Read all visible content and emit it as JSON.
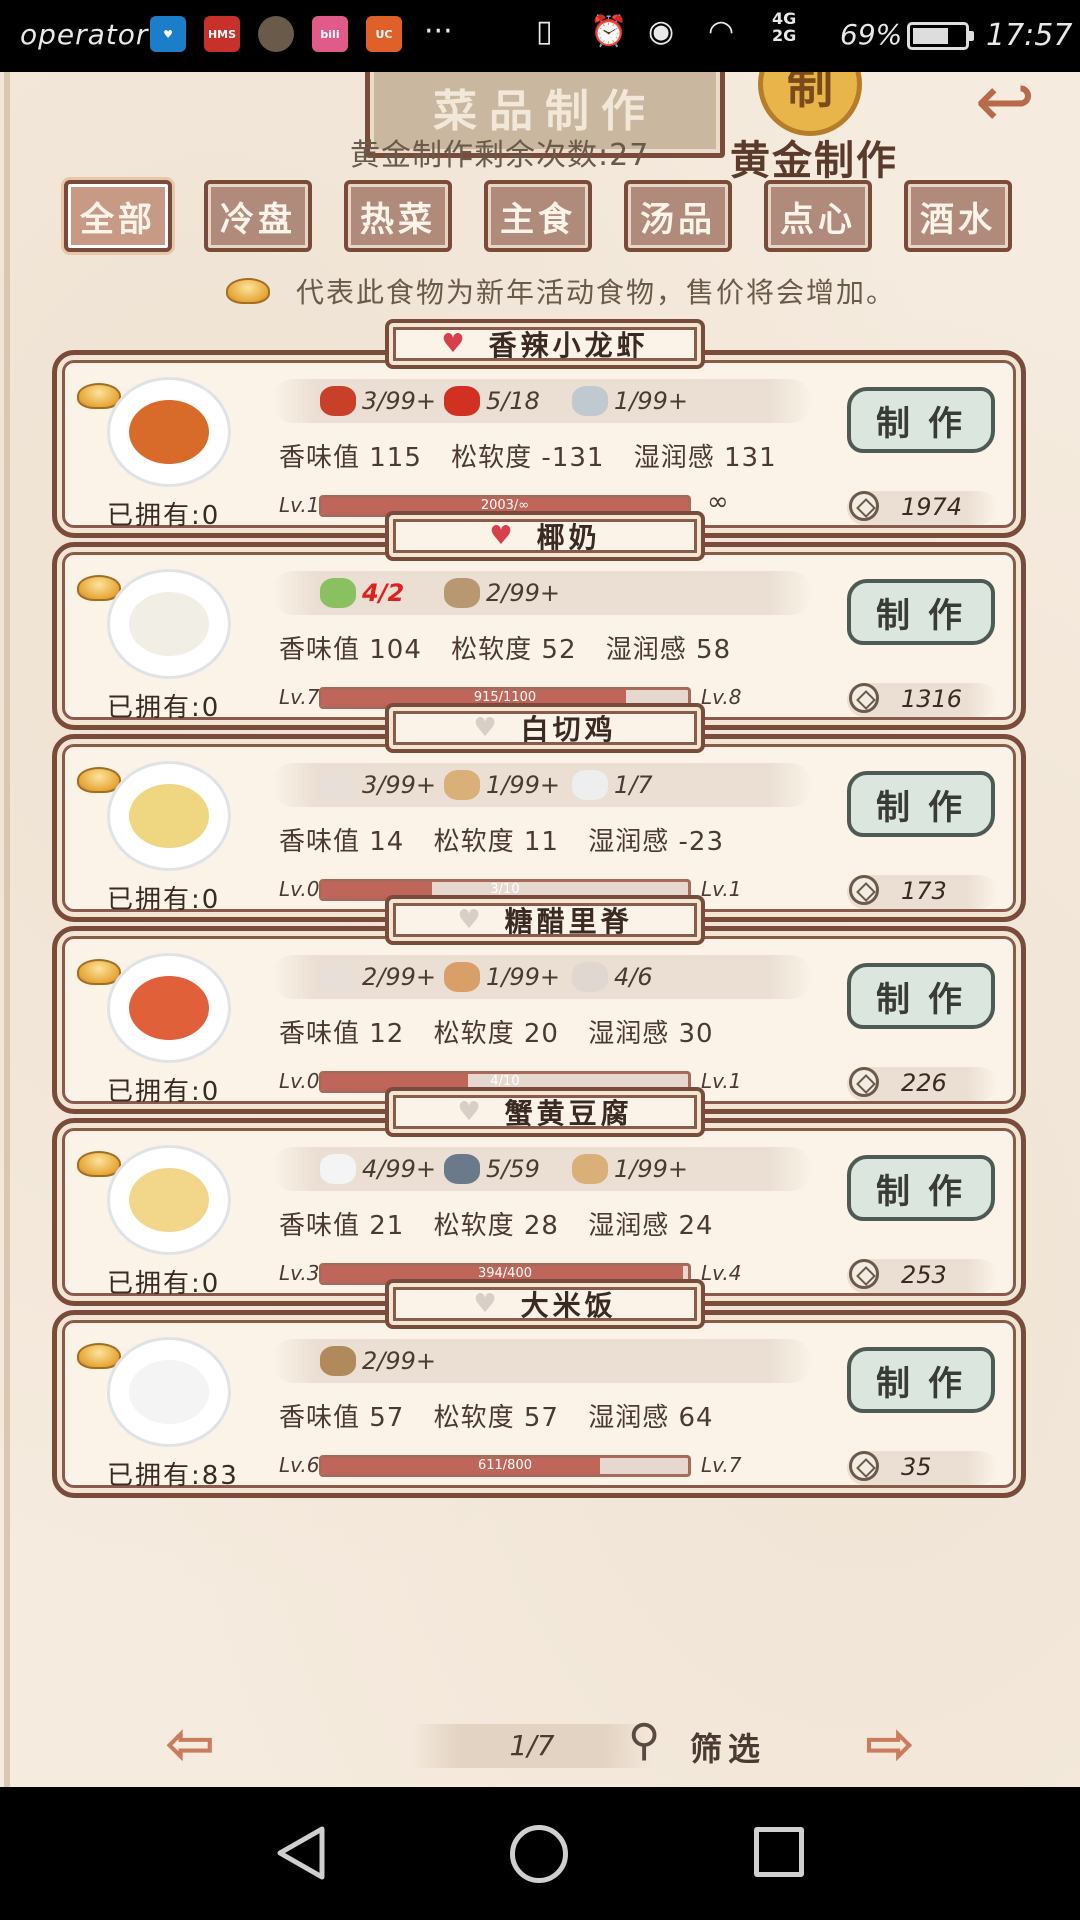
{
  "status_bar": {
    "operator": "operator",
    "apps": [
      "health-app",
      "HMS",
      "avatar-app",
      "bilibili",
      "uc-browser"
    ],
    "hms_label": "HMS",
    "more": "···",
    "network_top": "4G",
    "network_bottom": "2G",
    "battery_percent": "69%",
    "battery_level": 0.69,
    "time": "17:57"
  },
  "header": {
    "title": "菜品制作",
    "seal_char": "制",
    "gold_remaining": "黄金制作剩余次数:27",
    "gold_label": "黄金制作"
  },
  "tabs": [
    {
      "label": "全部",
      "active": true
    },
    {
      "label": "冷盘",
      "active": false
    },
    {
      "label": "热菜",
      "active": false
    },
    {
      "label": "主食",
      "active": false
    },
    {
      "label": "汤品",
      "active": false
    },
    {
      "label": "点心",
      "active": false
    },
    {
      "label": "酒水",
      "active": false
    }
  ],
  "notice": "代表此食物为新年活动食物，售价将会增加。",
  "dishes": [
    {
      "name": "香辣小龙虾",
      "favorite": true,
      "ingredients": [
        {
          "icon": "crayfish-icon",
          "qty": "3/99+",
          "short": false
        },
        {
          "icon": "chili-icon",
          "qty": "5/18",
          "short": false
        },
        {
          "icon": "pot-icon",
          "qty": "1/99+",
          "short": false
        }
      ],
      "stats": {
        "aroma": "香味值 115",
        "softness": "松软度 -131",
        "moisture": "湿润感 131"
      },
      "owned": "已拥有:0",
      "level": "Lv.10",
      "next_level": "∞",
      "progress_text": "2003/∞",
      "progress": 1.0,
      "price": "1974",
      "make_label": "制作",
      "food_color": "#d86a2a"
    },
    {
      "name": "椰奶",
      "favorite": true,
      "ingredients": [
        {
          "icon": "coconut-icon",
          "qty": "4/2",
          "short": true
        },
        {
          "icon": "barrel-icon",
          "qty": "2/99+",
          "short": false
        }
      ],
      "stats": {
        "aroma": "香味值 104",
        "softness": "松软度 52",
        "moisture": "湿润感 58"
      },
      "owned": "已拥有:0",
      "level": "Lv.7",
      "next_level": "Lv.8",
      "progress_text": "915/1100",
      "progress": 0.83,
      "price": "1316",
      "make_label": "制作",
      "food_color": "#f1eee6"
    },
    {
      "name": "白切鸡",
      "favorite": false,
      "ingredients": [
        {
          "icon": "chicken-icon",
          "qty": "3/99+",
          "short": false
        },
        {
          "icon": "ginger-icon",
          "qty": "1/99+",
          "short": false
        },
        {
          "icon": "bottle-icon",
          "qty": "1/7",
          "short": false
        }
      ],
      "stats": {
        "aroma": "香味值 14",
        "softness": "松软度 11",
        "moisture": "湿润感 -23"
      },
      "owned": "已拥有:0",
      "level": "Lv.0",
      "next_level": "Lv.1",
      "progress_text": "3/10",
      "progress": 0.3,
      "price": "173",
      "make_label": "制作",
      "food_color": "#efd680"
    },
    {
      "name": "糖醋里脊",
      "favorite": false,
      "ingredients": [
        {
          "icon": "chicken-icon",
          "qty": "2/99+",
          "short": false
        },
        {
          "icon": "egg-icon",
          "qty": "1/99+",
          "short": false
        },
        {
          "icon": "plate-icon",
          "qty": "4/6",
          "short": false
        }
      ],
      "stats": {
        "aroma": "香味值 12",
        "softness": "松软度 20",
        "moisture": "湿润感 30"
      },
      "owned": "已拥有:0",
      "level": "Lv.0",
      "next_level": "Lv.1",
      "progress_text": "4/10",
      "progress": 0.4,
      "price": "226",
      "make_label": "制作",
      "food_color": "#e0603a"
    },
    {
      "name": "蟹黄豆腐",
      "favorite": false,
      "ingredients": [
        {
          "icon": "tofu-icon",
          "qty": "4/99+",
          "short": false
        },
        {
          "icon": "crab-icon",
          "qty": "5/59",
          "short": false
        },
        {
          "icon": "ginger-icon",
          "qty": "1/99+",
          "short": false
        }
      ],
      "stats": {
        "aroma": "香味值 21",
        "softness": "松软度 28",
        "moisture": "湿润感 24"
      },
      "owned": "已拥有:0",
      "level": "Lv.3",
      "next_level": "Lv.4",
      "progress_text": "394/400",
      "progress": 0.985,
      "price": "253",
      "make_label": "制作",
      "food_color": "#f2d78a"
    },
    {
      "name": "大米饭",
      "favorite": false,
      "ingredients": [
        {
          "icon": "rice-stalk-icon",
          "qty": "2/99+",
          "short": false
        }
      ],
      "stats": {
        "aroma": "香味值 57",
        "softness": "松软度 57",
        "moisture": "湿润感 64"
      },
      "owned": "已拥有:83",
      "level": "Lv.6",
      "next_level": "Lv.7",
      "progress_text": "611/800",
      "progress": 0.76,
      "price": "35",
      "make_label": "制作",
      "food_color": "#f4f4f4"
    }
  ],
  "footer": {
    "page": "1/7",
    "filter_label": "筛选"
  },
  "colors": {
    "background": "#f5ebde",
    "frame": "#7a4a3a",
    "heart_active": "#d6404a",
    "shortage": "#e02020",
    "progress_fill": "#c0655a",
    "make_button": "#dbe6df"
  }
}
